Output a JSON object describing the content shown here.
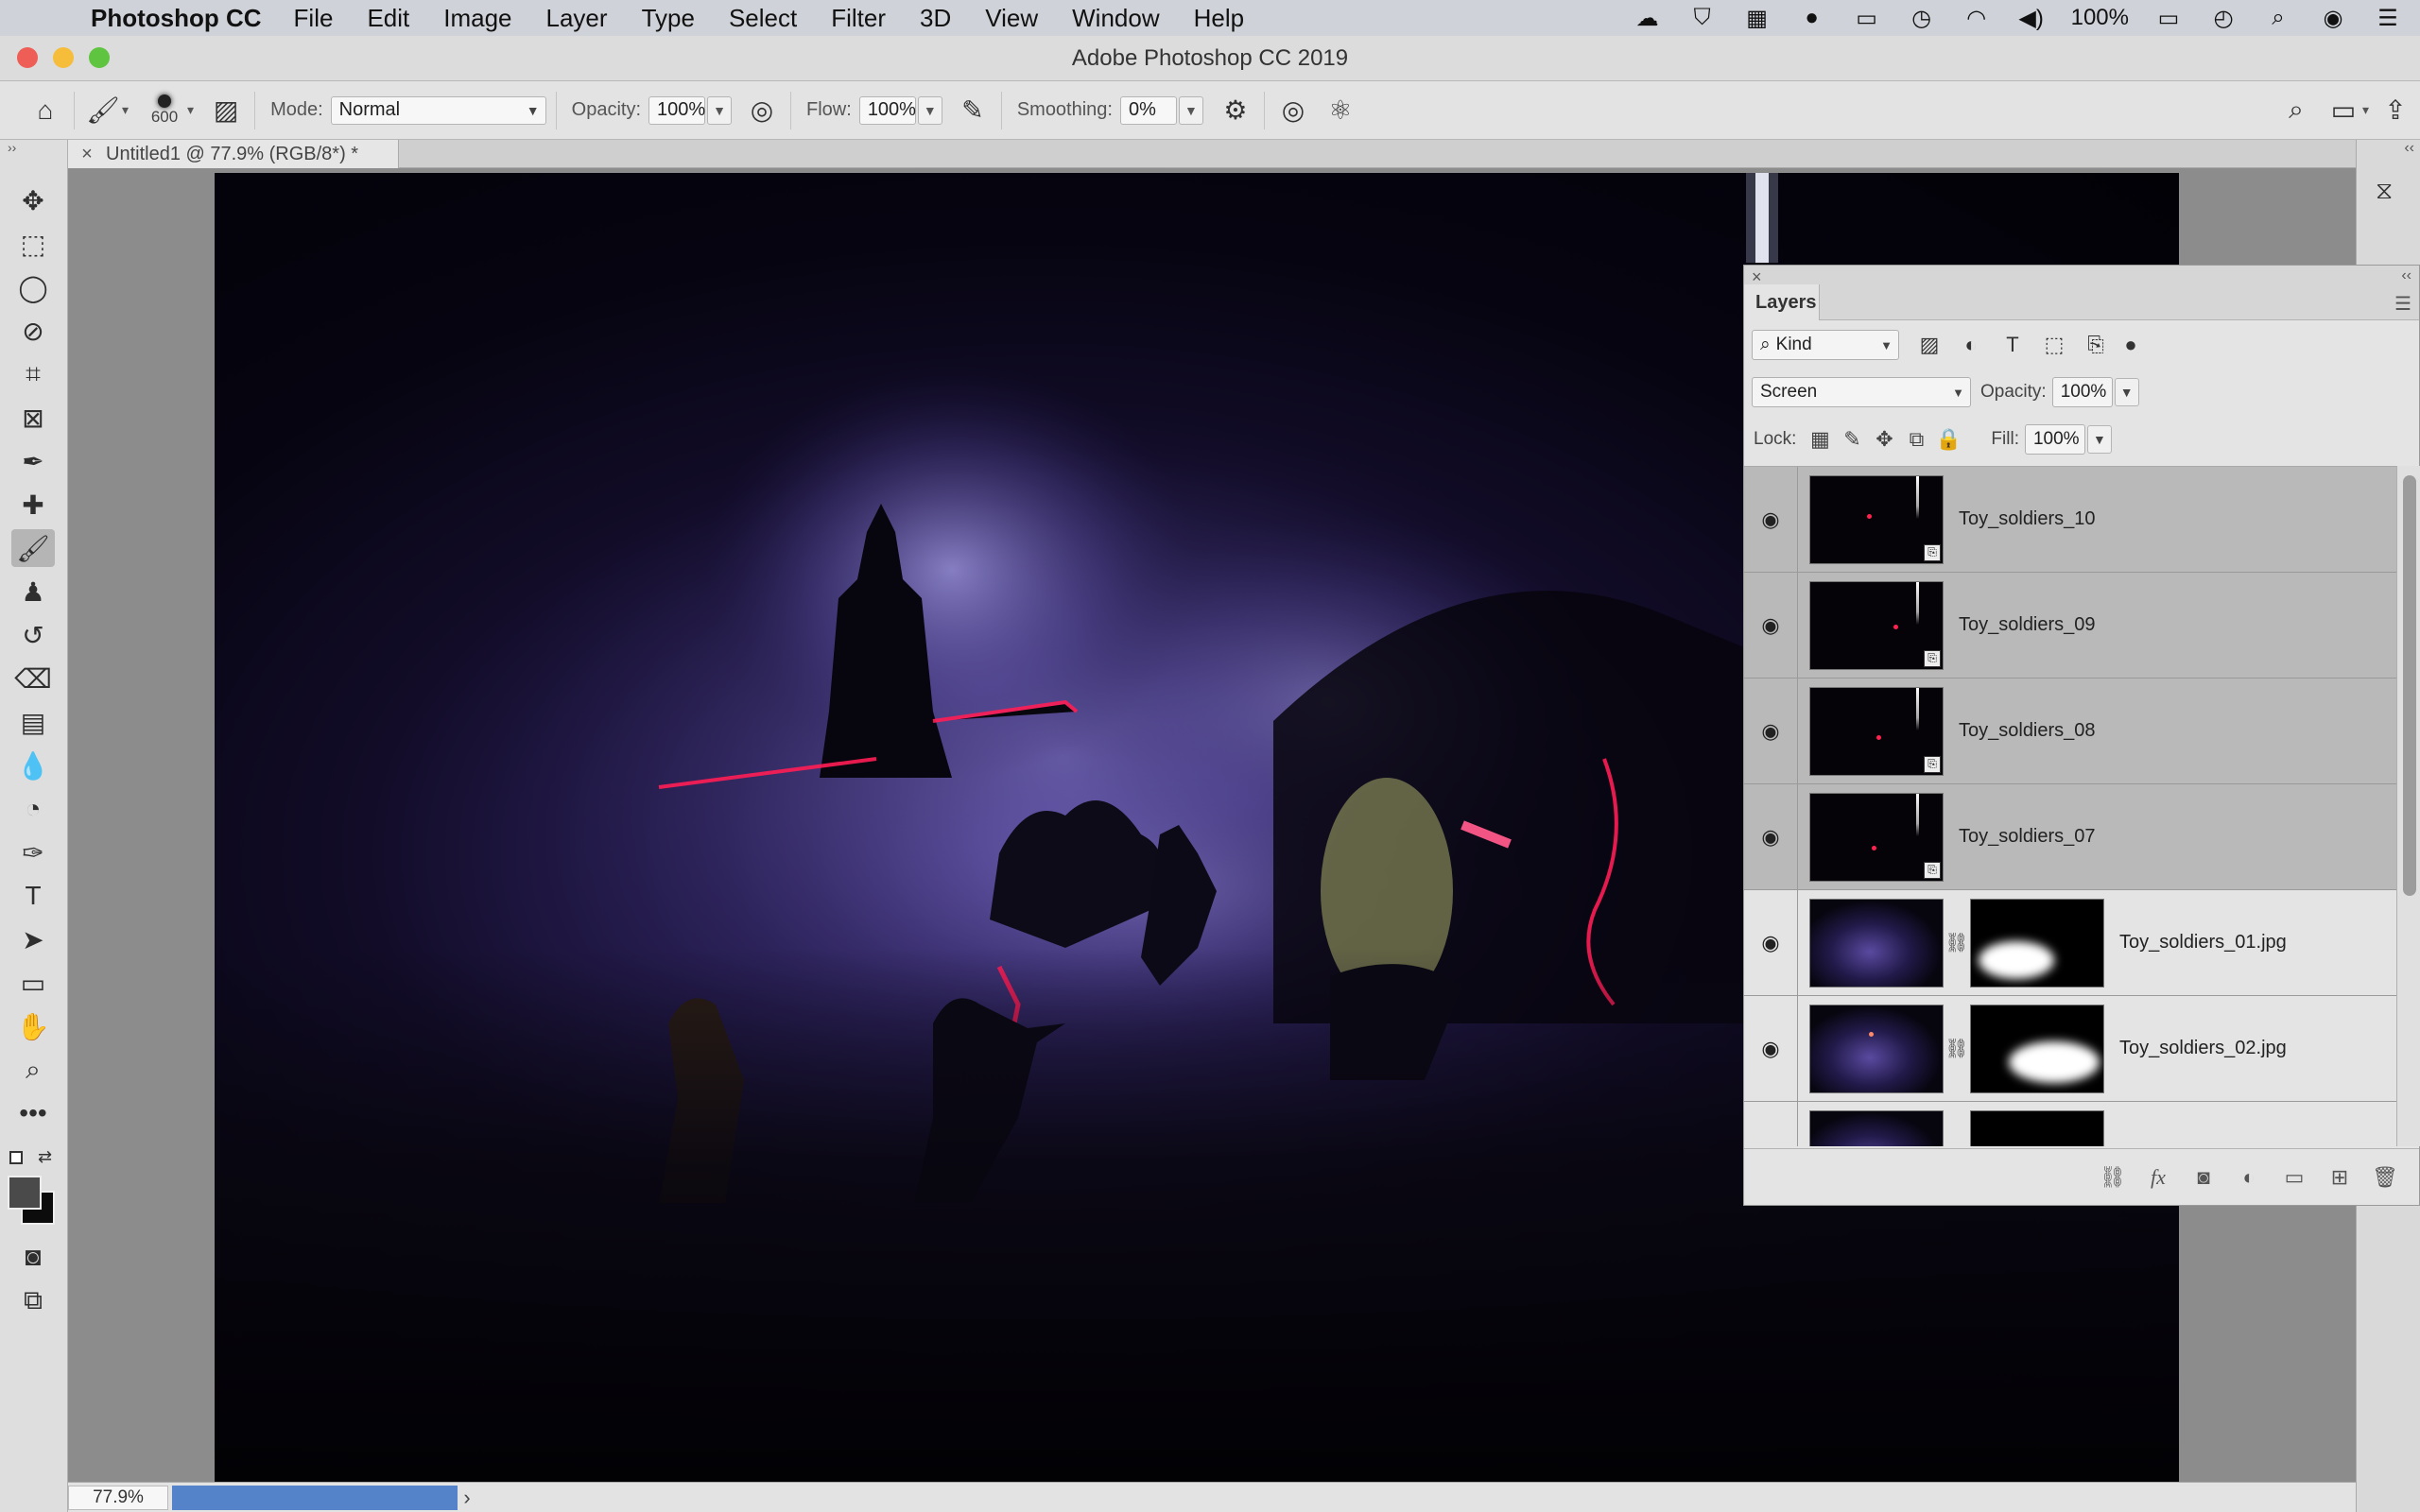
{
  "menubar": {
    "app_name": "Photoshop CC",
    "items": [
      "File",
      "Edit",
      "Image",
      "Layer",
      "Type",
      "Select",
      "Filter",
      "3D",
      "View",
      "Window",
      "Help"
    ],
    "battery": "100%"
  },
  "window": {
    "title": "Adobe Photoshop CC 2019"
  },
  "options": {
    "brush_size": "600",
    "mode_label": "Mode:",
    "mode_value": "Normal",
    "opacity_label": "Opacity:",
    "opacity_value": "100%",
    "flow_label": "Flow:",
    "flow_value": "100%",
    "smoothing_label": "Smoothing:",
    "smoothing_value": "0%"
  },
  "document": {
    "tab_title": "Untitled1 @ 77.9% (RGB/8*) *"
  },
  "status": {
    "zoom": "77.9%"
  },
  "layers_panel": {
    "title": "Layers",
    "filter_kind": "Kind",
    "blend_mode": "Screen",
    "opacity_label": "Opacity:",
    "opacity_value": "100%",
    "lock_label": "Lock:",
    "fill_label": "Fill:",
    "fill_value": "100%",
    "layers": [
      {
        "name": "Toy_soldiers_10",
        "selected": true
      },
      {
        "name": "Toy_soldiers_09",
        "selected": true
      },
      {
        "name": "Toy_soldiers_08",
        "selected": true
      },
      {
        "name": "Toy_soldiers_07",
        "selected": true
      },
      {
        "name": "Toy_soldiers_01.jpg",
        "selected": false
      },
      {
        "name": "Toy_soldiers_02.jpg",
        "selected": false
      }
    ]
  }
}
